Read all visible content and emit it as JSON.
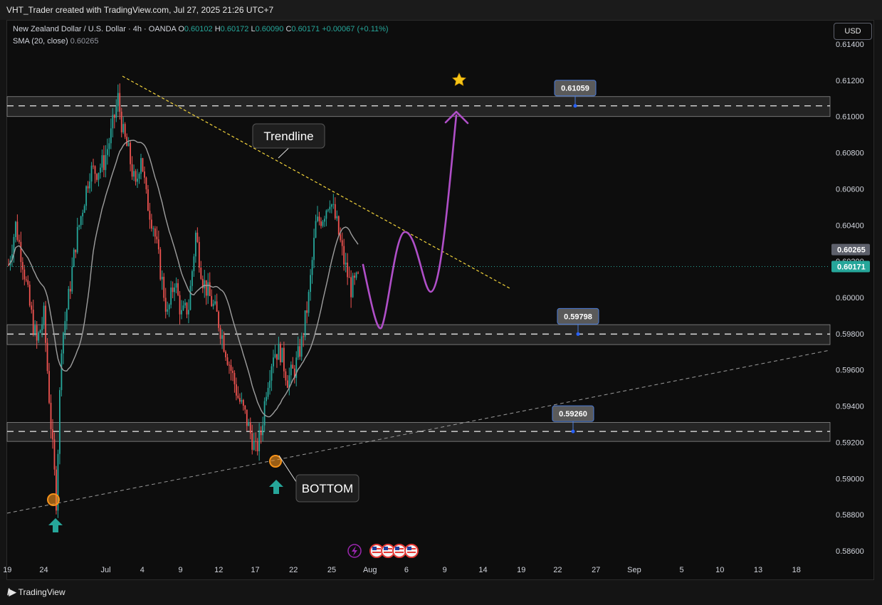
{
  "header": {
    "title": "VHT_Trader created with TradingView.com, Jul 27, 2025 21:26 UTC+7"
  },
  "legend": {
    "symbol": "New Zealand Dollar / U.S. Dollar · 4h · OANDA",
    "o_label": "O",
    "o_value": "0.60102",
    "h_label": "H",
    "h_value": "0.60172",
    "l_label": "L",
    "l_value": "0.60090",
    "c_label": "C",
    "c_value": "0.60171",
    "change": "+0.00067 (+0.11%)",
    "sma_label": "SMA (20, close)",
    "sma_value": "0.60265"
  },
  "currency_button": "USD",
  "footer": {
    "brand": "TradingView"
  },
  "colors": {
    "bull": "#26a69a",
    "bear": "#ef5350",
    "sma": "#9e9e9e",
    "trendline": "#f2d33b",
    "projection": "#b04fc8",
    "zone": "#3a3a3a",
    "marker": "#f7931a",
    "arrow": "#26a69a"
  },
  "chart_data": {
    "type": "candlestick",
    "timeframe": "4h",
    "y_axis": {
      "min": 0.585,
      "max": 0.6145,
      "ticks": [
        "0.61400",
        "0.61200",
        "0.61000",
        "0.60800",
        "0.60600",
        "0.60400",
        "0.60200",
        "0.60000",
        "0.59800",
        "0.59600",
        "0.59400",
        "0.59200",
        "0.59000",
        "0.58800",
        "0.58600"
      ]
    },
    "x_axis": {
      "ticks": [
        {
          "label": "19",
          "i": -28
        },
        {
          "label": "24",
          "i": -8
        },
        {
          "label": "Jul",
          "i": 26
        },
        {
          "label": "4",
          "i": 46
        },
        {
          "label": "9",
          "i": 67
        },
        {
          "label": "12",
          "i": 88
        },
        {
          "label": "17",
          "i": 108
        },
        {
          "label": "22",
          "i": 129
        },
        {
          "label": "25",
          "i": 150
        },
        {
          "label": "Aug",
          "i": 171
        },
        {
          "label": "6",
          "i": 191
        },
        {
          "label": "9",
          "i": 212
        },
        {
          "label": "14",
          "i": 233
        },
        {
          "label": "19",
          "i": 254
        },
        {
          "label": "22",
          "i": 274
        },
        {
          "label": "27",
          "i": 295
        },
        {
          "label": "Sep",
          "i": 316
        },
        {
          "label": "5",
          "i": 342
        },
        {
          "label": "10",
          "i": 363
        },
        {
          "label": "13",
          "i": 384
        },
        {
          "label": "18",
          "i": 405
        }
      ]
    },
    "price_path": [
      [
        0,
        0.6018
      ],
      [
        4,
        0.604
      ],
      [
        8,
        0.602
      ],
      [
        12,
        0.5995
      ],
      [
        16,
        0.5975
      ],
      [
        20,
        0.599
      ],
      [
        24,
        0.593
      ],
      [
        27,
        0.5888
      ],
      [
        30,
        0.5975
      ],
      [
        34,
        0.6
      ],
      [
        38,
        0.603
      ],
      [
        42,
        0.605
      ],
      [
        46,
        0.607
      ],
      [
        50,
        0.607
      ],
      [
        54,
        0.6075
      ],
      [
        58,
        0.609
      ],
      [
        62,
        0.611
      ],
      [
        65,
        0.609
      ],
      [
        68,
        0.608
      ],
      [
        72,
        0.606
      ],
      [
        75,
        0.608
      ],
      [
        78,
        0.6055
      ],
      [
        82,
        0.604
      ],
      [
        86,
        0.6015
      ],
      [
        90,
        0.599
      ],
      [
        94,
        0.601
      ],
      [
        98,
        0.599
      ],
      [
        102,
        0.5995
      ],
      [
        106,
        0.6035
      ],
      [
        110,
        0.601
      ],
      [
        114,
        0.6
      ],
      [
        118,
        0.599
      ],
      [
        122,
        0.5975
      ],
      [
        126,
        0.596
      ],
      [
        130,
        0.5945
      ],
      [
        134,
        0.5935
      ],
      [
        137,
        0.5925
      ],
      [
        140,
        0.5915
      ],
      [
        143,
        0.5925
      ],
      [
        146,
        0.595
      ],
      [
        150,
        0.597
      ],
      [
        154,
        0.597
      ],
      [
        158,
        0.5955
      ],
      [
        162,
        0.596
      ],
      [
        166,
        0.5975
      ],
      [
        170,
        0.6
      ],
      [
        174,
        0.604
      ],
      [
        178,
        0.6045
      ],
      [
        182,
        0.6055
      ],
      [
        186,
        0.604
      ],
      [
        190,
        0.602
      ],
      [
        194,
        0.6005
      ],
      [
        198,
        0.601
      ]
    ],
    "sma_value_last": 0.60265,
    "last_price": 0.60171,
    "horizontal_levels": [
      {
        "label": "0.61059",
        "price": 0.61059,
        "zone": [
          0.61,
          0.6111
        ]
      },
      {
        "label": "0.59798",
        "price": 0.59798,
        "zone": [
          0.5974,
          0.5985
        ]
      },
      {
        "label": "0.59260",
        "price": 0.5926,
        "zone": [
          0.59205,
          0.5931
        ]
      }
    ],
    "price_tags": [
      {
        "label": "0.60265",
        "price": 0.60265
      },
      {
        "label": "0.60171",
        "price": 0.60171
      }
    ],
    "annotations": [
      {
        "text": "Trendline"
      },
      {
        "text": "BOTTOM"
      }
    ]
  }
}
